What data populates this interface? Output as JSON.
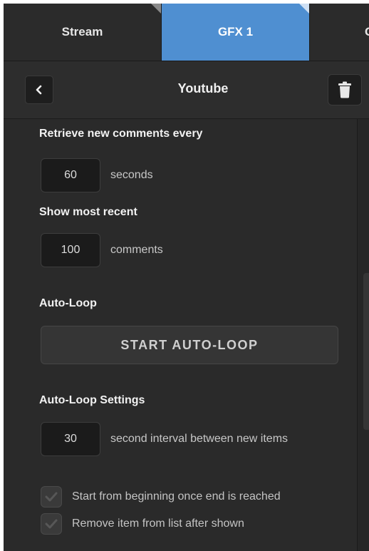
{
  "tabs": [
    {
      "label": "Stream",
      "active": false
    },
    {
      "label": "GFX 1",
      "active": true
    },
    {
      "label": "G",
      "active": false
    }
  ],
  "header": {
    "title": "Youtube",
    "back_icon": "chevron-left-icon",
    "delete_icon": "trash-icon"
  },
  "settings": {
    "retrieve_label": "Retrieve new comments every",
    "retrieve_value": "60",
    "retrieve_unit": "seconds",
    "show_label": "Show most recent",
    "show_value": "100",
    "show_unit": "comments",
    "autoloop_label": "Auto-Loop",
    "autoloop_button": "START AUTO-LOOP",
    "autoloop_settings_label": "Auto-Loop Settings",
    "interval_value": "30",
    "interval_unit": "second interval between new items",
    "options": [
      {
        "label": "Start from beginning once end is reached",
        "checked": true
      },
      {
        "label": "Remove item from list after shown",
        "checked": true
      }
    ]
  },
  "colors": {
    "active_tab": "#4f8fd1",
    "panel_bg": "#2a2a2a"
  }
}
